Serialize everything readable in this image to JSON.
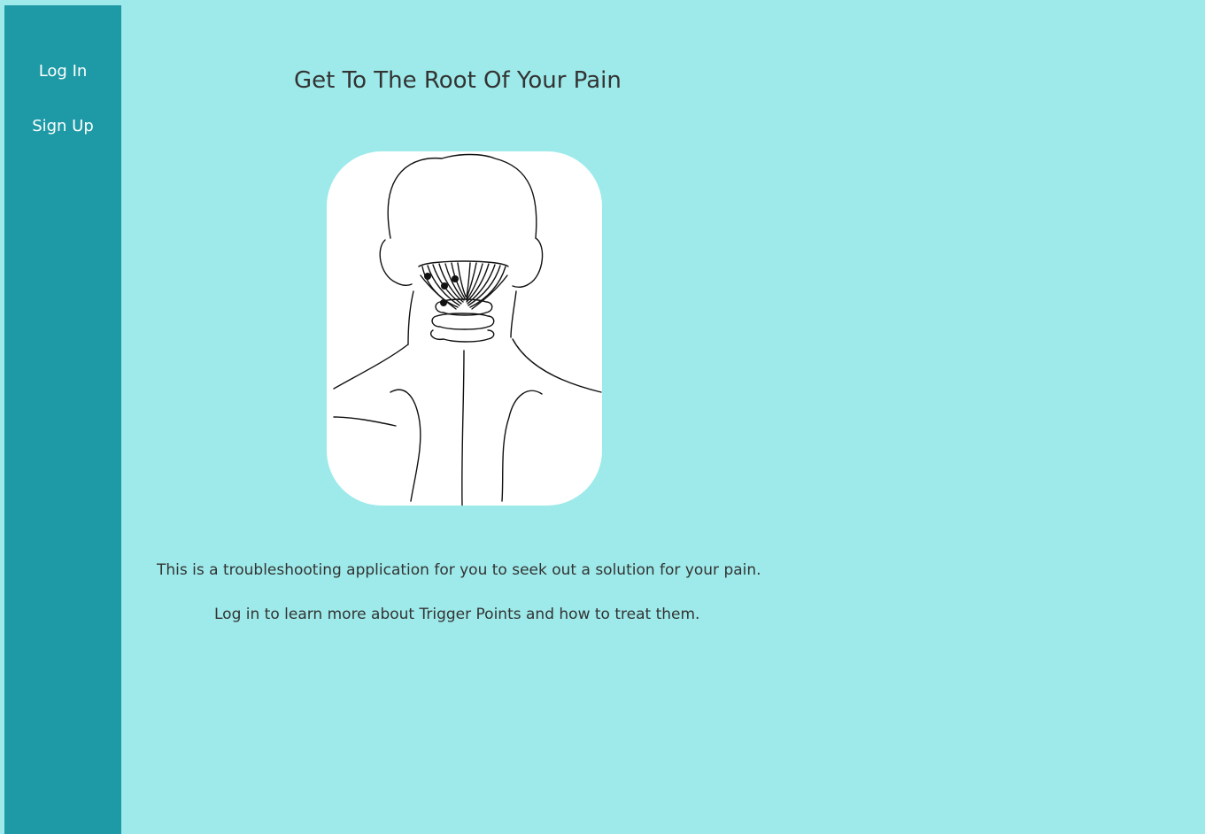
{
  "sidebar": {
    "login_label": "Log In",
    "signup_label": "Sign Up"
  },
  "main": {
    "title": "Get To The Root Of Your Pain",
    "illustration_icon": "neck-trigger-points-illustration",
    "intro_text": "This is a troubleshooting application for you to seek out a solution for your pain.",
    "login_prompt": "Log in to learn more about Trigger Points and how to treat them."
  },
  "colors": {
    "page_background": "#9eeaea",
    "sidebar_background": "#1e9aa6",
    "sidebar_text": "#ffffff",
    "body_text": "#333333",
    "illustration_background": "#ffffff"
  }
}
